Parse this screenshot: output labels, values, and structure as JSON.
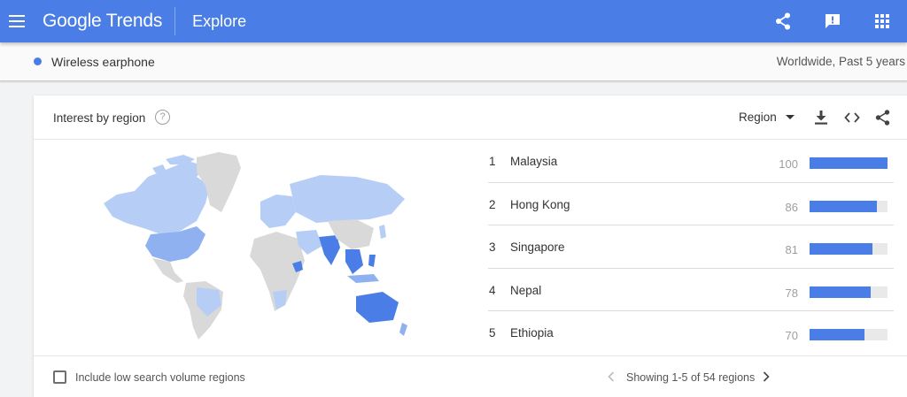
{
  "app": {
    "logo_text": "Google Trends",
    "page_title": "Explore"
  },
  "icons": {
    "menu": "menu-icon",
    "share": "share-icon",
    "feedback": "feedback-icon",
    "apps": "apps-grid-icon",
    "help": "help-icon",
    "download": "download-icon",
    "embed": "embed-code-icon",
    "card_share": "share-icon",
    "prev": "chevron-left-icon",
    "next": "chevron-right-icon"
  },
  "term": {
    "label": "Wireless earphone",
    "color": "#4a7ee6",
    "meta": "Worldwide, Past 5 years"
  },
  "card": {
    "title": "Interest by region",
    "help_glyph": "?",
    "region_select": "Region"
  },
  "rankings": [
    {
      "rank": "1",
      "name": "Malaysia",
      "value": 100
    },
    {
      "rank": "2",
      "name": "Hong Kong",
      "value": 86
    },
    {
      "rank": "3",
      "name": "Singapore",
      "value": 81
    },
    {
      "rank": "4",
      "name": "Nepal",
      "value": 78
    },
    {
      "rank": "5",
      "name": "Ethiopia",
      "value": 70
    }
  ],
  "footer": {
    "checkbox_label": "Include low search volume regions",
    "checked": false,
    "pager_text": "Showing 1-5 of 54 regions"
  },
  "colors": {
    "accent": "#4a7ee6",
    "map_high": "#4a7ee6",
    "map_mid": "#8fb1f0",
    "map_low": "#b6cdf6",
    "map_none": "#d9d9d9"
  }
}
